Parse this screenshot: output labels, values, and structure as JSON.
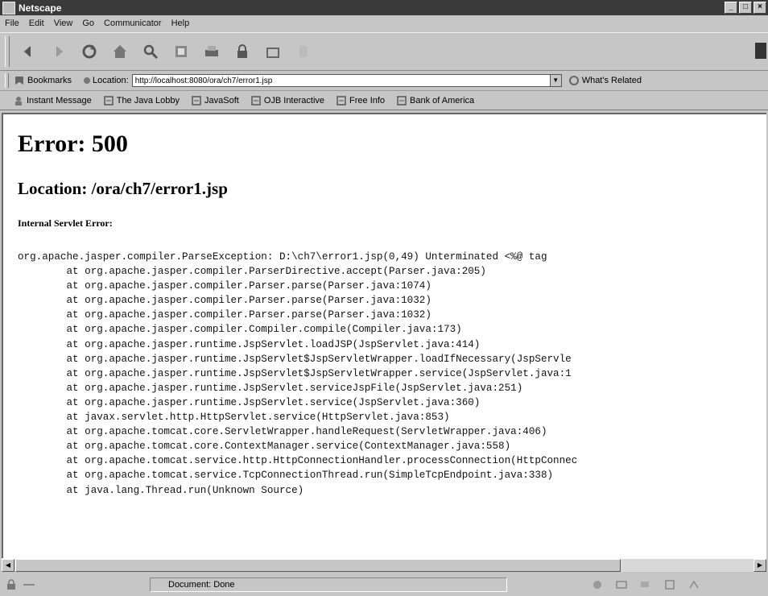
{
  "window": {
    "title": "Netscape"
  },
  "menu": [
    "File",
    "Edit",
    "View",
    "Go",
    "Communicator",
    "Help"
  ],
  "toolbar": {
    "buttons": [
      "back",
      "forward",
      "reload",
      "home",
      "search",
      "netscape",
      "print",
      "security",
      "shop",
      "stop"
    ]
  },
  "location_bar": {
    "bookmarks_label": "Bookmarks",
    "location_label": "Location:",
    "url": "http://localhost:8080/ora/ch7/error1.jsp",
    "related_label": "What's Related"
  },
  "personal_toolbar": {
    "items": [
      "Instant Message",
      "The Java Lobby",
      "JavaSoft",
      "OJB Interactive",
      "Free Info",
      "Bank of America"
    ]
  },
  "page": {
    "heading": "Error: 500",
    "location": "Location: /ora/ch7/error1.jsp",
    "error_type": "Internal Servlet Error:",
    "stack_trace": [
      "org.apache.jasper.compiler.ParseException: D:\\ch7\\error1.jsp(0,49) Unterminated <%@ tag",
      "        at org.apache.jasper.compiler.ParserDirective.accept(Parser.java:205)",
      "        at org.apache.jasper.compiler.Parser.parse(Parser.java:1074)",
      "        at org.apache.jasper.compiler.Parser.parse(Parser.java:1032)",
      "        at org.apache.jasper.compiler.Parser.parse(Parser.java:1032)",
      "        at org.apache.jasper.compiler.Compiler.compile(Compiler.java:173)",
      "        at org.apache.jasper.runtime.JspServlet.loadJSP(JspServlet.java:414)",
      "        at org.apache.jasper.runtime.JspServlet$JspServletWrapper.loadIfNecessary(JspServle",
      "        at org.apache.jasper.runtime.JspServlet$JspServletWrapper.service(JspServlet.java:1",
      "        at org.apache.jasper.runtime.JspServlet.serviceJspFile(JspServlet.java:251)",
      "        at org.apache.jasper.runtime.JspServlet.service(JspServlet.java:360)",
      "        at javax.servlet.http.HttpServlet.service(HttpServlet.java:853)",
      "        at org.apache.tomcat.core.ServletWrapper.handleRequest(ServletWrapper.java:406)",
      "        at org.apache.tomcat.core.ContextManager.service(ContextManager.java:558)",
      "        at org.apache.tomcat.service.http.HttpConnectionHandler.processConnection(HttpConnec",
      "        at org.apache.tomcat.service.TcpConnectionThread.run(SimpleTcpEndpoint.java:338)",
      "        at java.lang.Thread.run(Unknown Source)"
    ]
  },
  "status": {
    "text": "Document: Done"
  }
}
